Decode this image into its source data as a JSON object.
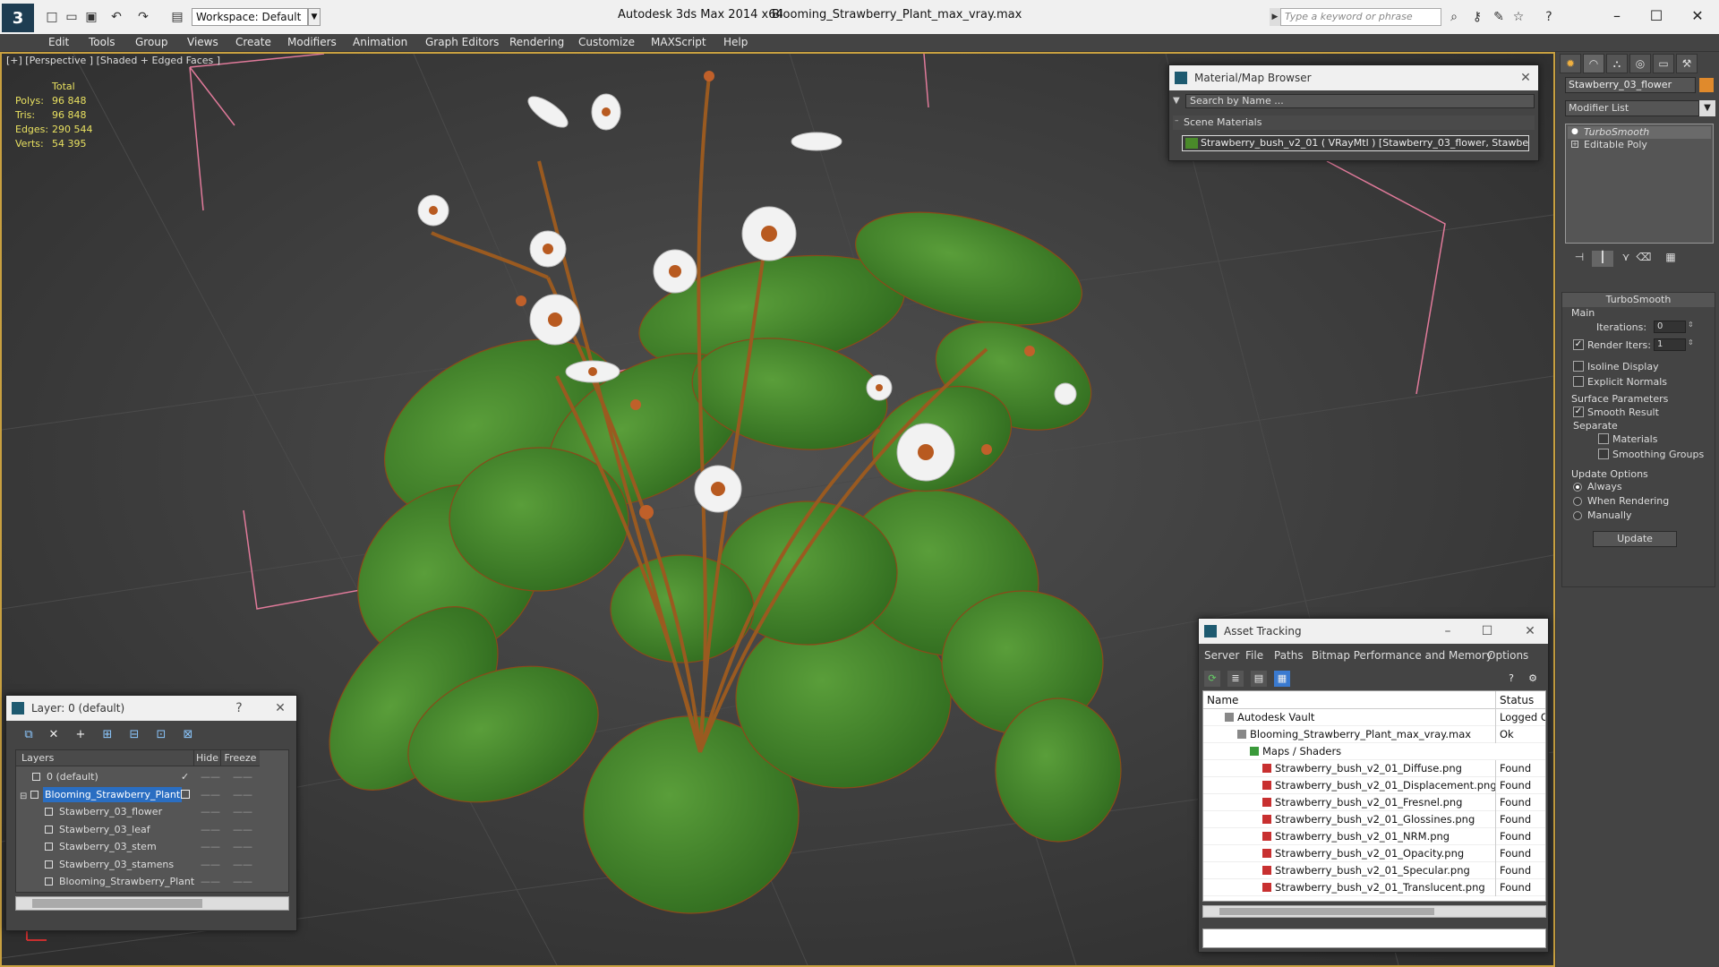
{
  "titlebar": {
    "workspace_label": "Workspace: Default",
    "app_title": "Autodesk 3ds Max  2014 x64",
    "doc_title": "Blooming_Strawberry_Plant_max_vray.max",
    "search_placeholder": "Type a keyword or phrase"
  },
  "menu": [
    "Edit",
    "Tools",
    "Group",
    "Views",
    "Create",
    "Modifiers",
    "Animation",
    "Graph Editors",
    "Rendering",
    "Customize",
    "MAXScript",
    "Help"
  ],
  "viewport": {
    "label": "[+] [Perspective ] [Shaded + Edged Faces ]",
    "stats_header": "Total",
    "stats": [
      {
        "label": "Polys:",
        "value": "96 848"
      },
      {
        "label": "Tris:",
        "value": "96 848"
      },
      {
        "label": "Edges:",
        "value": "290 544"
      },
      {
        "label": "Verts:",
        "value": "54 395"
      }
    ]
  },
  "command_panel": {
    "object_name": "Stawberry_03_flower",
    "object_color": "#e08a2c",
    "modifier_list": "Modifier List",
    "stack": [
      "TurboSmooth",
      "Editable Poly"
    ],
    "rollout_title": "TurboSmooth",
    "main_label": "Main",
    "iterations_label": "Iterations:",
    "iterations_value": "0",
    "render_iters_label": "Render Iters:",
    "render_iters_value": "1",
    "isoline_label": "Isoline Display",
    "explicit_normals_label": "Explicit Normals",
    "surface_params_label": "Surface Parameters",
    "smooth_result_label": "Smooth Result",
    "separate_label": "Separate",
    "materials_label": "Materials",
    "smoothing_groups_label": "Smoothing Groups",
    "update_options_label": "Update Options",
    "always_label": "Always",
    "when_rendering_label": "When Rendering",
    "manually_label": "Manually",
    "update_button": "Update"
  },
  "material_browser": {
    "title": "Material/Map Browser",
    "search_placeholder": "Search by Name ...",
    "group": "Scene Materials",
    "item": "Strawberry_bush_v2_01  ( VRayMtl )  [Stawberry_03_flower, Stawbe..."
  },
  "asset_tracking": {
    "title": "Asset Tracking",
    "menu": [
      "Server",
      "File",
      "Paths",
      "Bitmap Performance and Memory",
      "Options"
    ],
    "col_name": "Name",
    "col_status": "Status",
    "rows": [
      {
        "name": "Autodesk Vault",
        "status": "Logged O",
        "indent": 1
      },
      {
        "name": "Blooming_Strawberry_Plant_max_vray.max",
        "status": "Ok",
        "indent": 2
      },
      {
        "name": "Maps / Shaders",
        "status": "",
        "indent": 3
      },
      {
        "name": "Strawberry_bush_v2_01_Diffuse.png",
        "status": "Found",
        "indent": 4
      },
      {
        "name": "Strawberry_bush_v2_01_Displacement.png",
        "status": "Found",
        "indent": 4
      },
      {
        "name": "Strawberry_bush_v2_01_Fresnel.png",
        "status": "Found",
        "indent": 4
      },
      {
        "name": "Strawberry_bush_v2_01_Glossines.png",
        "status": "Found",
        "indent": 4
      },
      {
        "name": "Strawberry_bush_v2_01_NRM.png",
        "status": "Found",
        "indent": 4
      },
      {
        "name": "Strawberry_bush_v2_01_Opacity.png",
        "status": "Found",
        "indent": 4
      },
      {
        "name": "Strawberry_bush_v2_01_Specular.png",
        "status": "Found",
        "indent": 4
      },
      {
        "name": "Strawberry_bush_v2_01_Translucent.png",
        "status": "Found",
        "indent": 4
      }
    ]
  },
  "layer_manager": {
    "title": "Layer: 0 (default)",
    "help": "?",
    "col_layers": "Layers",
    "col_hide": "Hide",
    "col_freeze": "Freeze",
    "rows": [
      {
        "name": "0 (default)",
        "indent": 1,
        "selected": false
      },
      {
        "name": "Blooming_Strawberry_Plant",
        "indent": 0,
        "selected": true
      },
      {
        "name": "Stawberry_03_flower",
        "indent": 2,
        "selected": false
      },
      {
        "name": "Stawberry_03_leaf",
        "indent": 2,
        "selected": false
      },
      {
        "name": "Stawberry_03_stem",
        "indent": 2,
        "selected": false
      },
      {
        "name": "Stawberry_03_stamens",
        "indent": 2,
        "selected": false
      },
      {
        "name": "Blooming_Strawberry_Plant",
        "indent": 2,
        "selected": false
      }
    ]
  }
}
